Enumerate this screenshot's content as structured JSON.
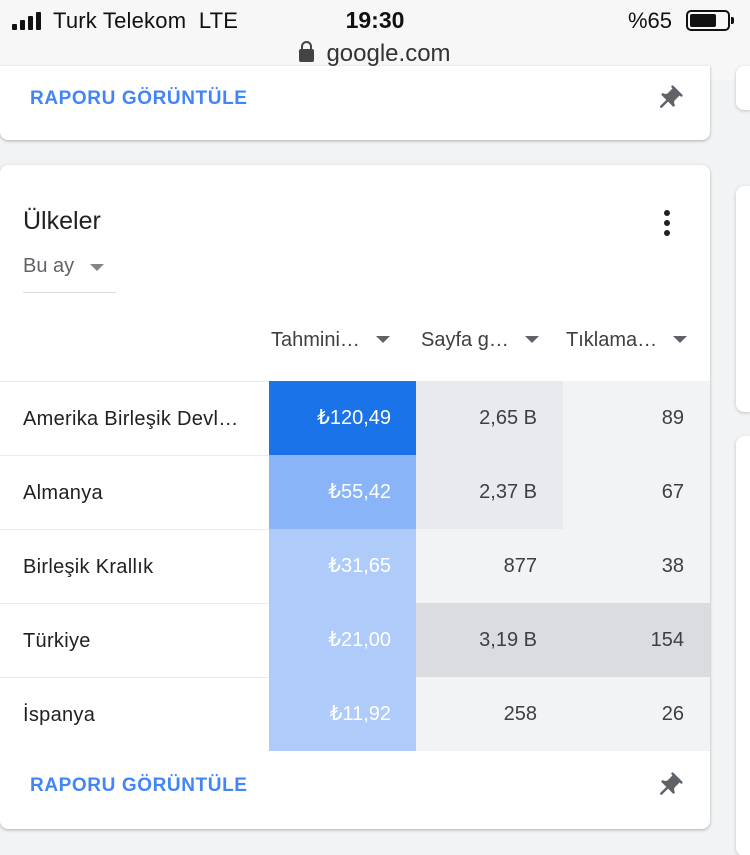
{
  "status_bar": {
    "carrier": "Turk Telekom",
    "network": "LTE",
    "time": "19:30",
    "battery": "%65",
    "url": "google.com"
  },
  "top_card": {
    "view_report": "RAPORU GÖRÜNTÜLE",
    "pin_icon": "pin-icon"
  },
  "countries_card": {
    "title": "Ülkeler",
    "date_range": "Bu ay",
    "view_report": "RAPORU GÖRÜNTÜLE",
    "menu_icon": "more-vert-icon",
    "pin_icon": "pin-icon",
    "columns": [
      "Tahmini…",
      "Sayfa g…",
      "Tıklama…"
    ],
    "rows": [
      {
        "country": "Amerika Birleşik Devl…",
        "earnings": "₺120,49",
        "page_views": "2,65 B",
        "clicks": "89"
      },
      {
        "country": "Almanya",
        "earnings": "₺55,42",
        "page_views": "2,37 B",
        "clicks": "67"
      },
      {
        "country": "Birleşik Krallık",
        "earnings": "₺31,65",
        "page_views": "877",
        "clicks": "38"
      },
      {
        "country": "Türkiye",
        "earnings": "₺21,00",
        "page_views": "3,19 B",
        "clicks": "154"
      },
      {
        "country": "İspanya",
        "earnings": "₺11,92",
        "page_views": "258",
        "clicks": "26"
      }
    ]
  },
  "colors": {
    "accent_blue": "#4285f4",
    "heat_blue_strongest": "#1a73e8",
    "heat_blue_strong": "#8ab4f8",
    "heat_blue_light": "#aecbfa",
    "heat_gray_dark": "#dadce0",
    "heat_gray_mid": "#e8eaed",
    "heat_gray_light": "#f1f3f4"
  }
}
